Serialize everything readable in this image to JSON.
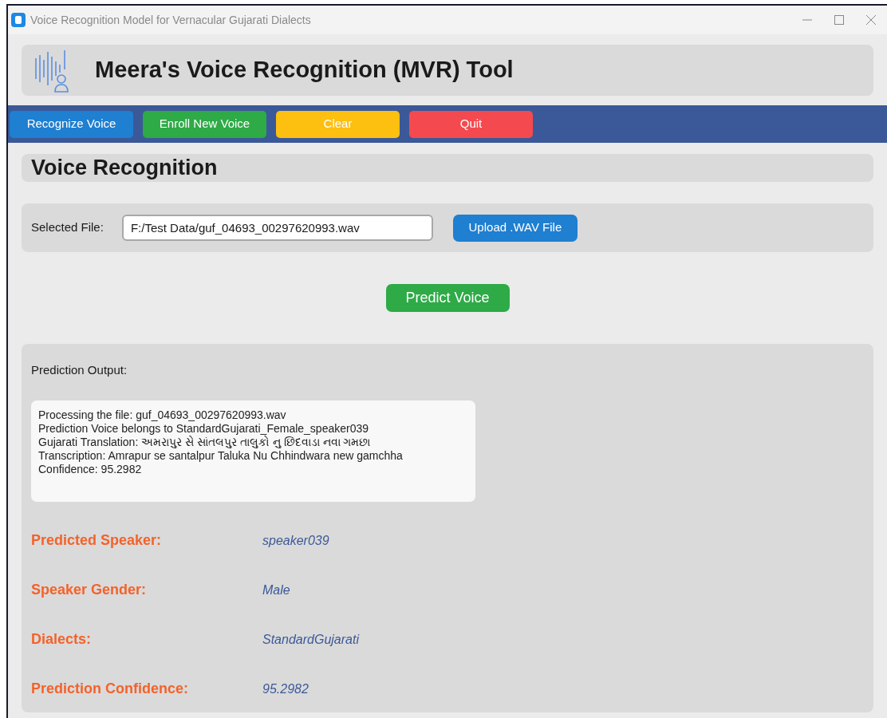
{
  "window": {
    "title": "Voice Recognition Model for Vernacular Gujarati Dialects"
  },
  "header": {
    "title": "Meera's Voice Recognition (MVR) Tool"
  },
  "toolbar": [
    {
      "label": "Recognize Voice",
      "kind": "blue"
    },
    {
      "label": "Enroll New Voice",
      "kind": "green"
    },
    {
      "label": "Clear",
      "kind": "yellow"
    },
    {
      "label": "Quit",
      "kind": "red"
    }
  ],
  "section": {
    "title": "Voice Recognition"
  },
  "file": {
    "label": "Selected File:",
    "value": "F:/Test Data/guf_04693_00297620993.wav",
    "upload_button": "Upload .WAV File"
  },
  "predict_button": "Predict Voice",
  "output": {
    "label": "Prediction Output:",
    "lines": [
      "Processing the file: guf_04693_00297620993.wav",
      "Prediction Voice belongs to StandardGujarati_Female_speaker039",
      "Gujarati Translation: અમરાપુર સે સાંતલપુર તાલુકો નુ છિંદવાડા નવા ગમછા",
      "Transcription: Amrapur se santalpur Taluka Nu Chhindwara new gamchha",
      "Confidence: 95.2982"
    ]
  },
  "results": [
    {
      "label": "Predicted Speaker:",
      "value": "speaker039"
    },
    {
      "label": "Speaker Gender:",
      "value": "Male"
    },
    {
      "label": "Dialects:",
      "value": "StandardGujarati"
    },
    {
      "label": "Prediction Confidence:",
      "value": "95.2982"
    }
  ]
}
